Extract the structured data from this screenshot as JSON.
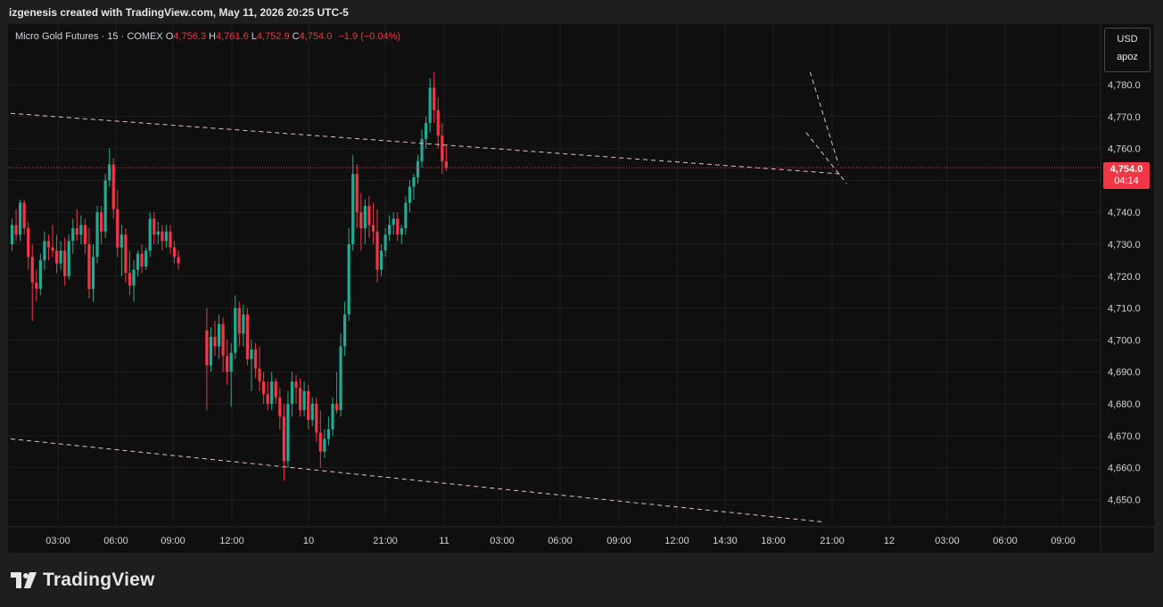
{
  "caption": "izgenesis created with TradingView.com, May 11, 2026 20:25 UTC-5",
  "legend": {
    "symbol": "Micro Gold Futures · 15 · COMEX",
    "o_label": "O",
    "o_value": "4,756.3",
    "h_label": "H",
    "h_value": "4,761.6",
    "l_label": "L",
    "l_value": "4,752.9",
    "c_label": "C",
    "c_value": "4,754.0",
    "change": "−1.9 (−0.04%)"
  },
  "currency": {
    "code": "USD",
    "unit": "apoz"
  },
  "last_price": {
    "price": "4,754.0",
    "countdown": "04:14"
  },
  "brand": "TradingView",
  "colors": {
    "up": "#22ab94",
    "down": "#f23645",
    "background": "#0f0f0f",
    "grid": "#1f1f1f"
  },
  "chart_data": {
    "type": "candlestick",
    "y_ticks": [
      "4,780.0",
      "4,770.0",
      "4,760.0",
      "4,750.0",
      "4,740.0",
      "4,730.0",
      "4,720.0",
      "4,710.0",
      "4,700.0",
      "4,690.0",
      "4,680.0",
      "4,670.0",
      "4,660.0",
      "4,650.0"
    ],
    "ylim": [
      4643,
      4794
    ],
    "x_ticks": [
      "03:00",
      "06:00",
      "09:00",
      "12:00",
      "10",
      "21:00",
      "11",
      "03:00",
      "06:00",
      "09:00",
      "12:00",
      "14:30",
      "18:00",
      "21:00",
      "12",
      "03:00",
      "06:00",
      "09:00"
    ],
    "last_price": 4754.0,
    "trendlines": [
      {
        "from": [
          0,
          4771.0
        ],
        "to": [
          205,
          4752.0
        ]
      },
      {
        "from": [
          0,
          4669.0
        ],
        "to": [
          200,
          4643.0
        ]
      },
      {
        "from": [
          197,
          4784.0
        ],
        "to": [
          204,
          4755.0
        ]
      },
      {
        "from": [
          196,
          4765.0
        ],
        "to": [
          206,
          4749.0
        ]
      }
    ],
    "candles": [
      [
        4730,
        4738,
        4728,
        4736
      ],
      [
        4736,
        4741,
        4731,
        4733
      ],
      [
        4733,
        4744,
        4731,
        4743
      ],
      [
        4743,
        4744,
        4733,
        4735
      ],
      [
        4735,
        4737,
        4722,
        4726
      ],
      [
        4726,
        4730,
        4706,
        4718
      ],
      [
        4718,
        4722,
        4712,
        4716
      ],
      [
        4716,
        4727,
        4714,
        4725
      ],
      [
        4725,
        4734,
        4722,
        4731
      ],
      [
        4731,
        4733,
        4725,
        4729
      ],
      [
        4729,
        4736,
        4726,
        4728
      ],
      [
        4728,
        4733,
        4721,
        4724
      ],
      [
        4724,
        4731,
        4722,
        4728
      ],
      [
        4728,
        4732,
        4717,
        4720
      ],
      [
        4720,
        4733,
        4719,
        4731
      ],
      [
        4731,
        4738,
        4727,
        4735
      ],
      [
        4735,
        4741,
        4731,
        4733
      ],
      [
        4733,
        4739,
        4730,
        4736
      ],
      [
        4736,
        4738,
        4727,
        4730
      ],
      [
        4730,
        4735,
        4713,
        4716
      ],
      [
        4716,
        4730,
        4712,
        4726
      ],
      [
        4726,
        4742,
        4724,
        4740
      ],
      [
        4740,
        4742,
        4730,
        4734
      ],
      [
        4734,
        4752,
        4732,
        4750
      ],
      [
        4750,
        4760,
        4748,
        4755
      ],
      [
        4755,
        4757,
        4738,
        4741
      ],
      [
        4741,
        4747,
        4726,
        4729
      ],
      [
        4729,
        4736,
        4720,
        4733
      ],
      [
        4733,
        4735,
        4718,
        4721
      ],
      [
        4721,
        4728,
        4714,
        4717
      ],
      [
        4717,
        4725,
        4712,
        4722
      ],
      [
        4722,
        4728,
        4720,
        4727
      ],
      [
        4727,
        4730,
        4721,
        4723
      ],
      [
        4723,
        4729,
        4722,
        4728
      ],
      [
        4728,
        4740,
        4726,
        4738
      ],
      [
        4738,
        4740,
        4730,
        4733
      ],
      [
        4733,
        4737,
        4730,
        4734
      ],
      [
        4734,
        4736,
        4728,
        4731
      ],
      [
        4731,
        4736,
        4729,
        4734
      ],
      [
        4734,
        4736,
        4727,
        4729
      ],
      [
        4729,
        4731,
        4724,
        4726
      ],
      [
        4726,
        4728,
        4722,
        4724
      ],
      [
        4703,
        4710,
        4678,
        4692
      ],
      [
        4692,
        4704,
        4690,
        4701
      ],
      [
        4701,
        4706,
        4695,
        4698
      ],
      [
        4698,
        4708,
        4694,
        4705
      ],
      [
        4705,
        4707,
        4690,
        4695
      ],
      [
        4695,
        4700,
        4686,
        4690
      ],
      [
        4690,
        4699,
        4679,
        4696
      ],
      [
        4696,
        4714,
        4694,
        4710
      ],
      [
        4710,
        4712,
        4698,
        4702
      ],
      [
        4702,
        4711,
        4698,
        4708
      ],
      [
        4708,
        4710,
        4692,
        4694
      ],
      [
        4694,
        4700,
        4684,
        4697
      ],
      [
        4697,
        4699,
        4688,
        4691
      ],
      [
        4691,
        4698,
        4684,
        4687
      ],
      [
        4687,
        4690,
        4680,
        4683
      ],
      [
        4683,
        4687,
        4678,
        4680
      ],
      [
        4680,
        4690,
        4678,
        4687
      ],
      [
        4687,
        4688,
        4680,
        4682
      ],
      [
        4682,
        4685,
        4672,
        4676
      ],
      [
        4676,
        4680,
        4656,
        4662
      ],
      [
        4662,
        4684,
        4660,
        4680
      ],
      [
        4680,
        4690,
        4676,
        4687
      ],
      [
        4687,
        4689,
        4680,
        4685
      ],
      [
        4685,
        4688,
        4676,
        4678
      ],
      [
        4678,
        4687,
        4676,
        4684
      ],
      [
        4684,
        4686,
        4672,
        4675
      ],
      [
        4675,
        4682,
        4673,
        4680
      ],
      [
        4680,
        4682,
        4668,
        4671
      ],
      [
        4671,
        4678,
        4660,
        4665
      ],
      [
        4665,
        4672,
        4663,
        4669
      ],
      [
        4669,
        4676,
        4667,
        4672
      ],
      [
        4672,
        4682,
        4670,
        4680
      ],
      [
        4680,
        4690,
        4677,
        4678
      ],
      [
        4678,
        4702,
        4676,
        4698
      ],
      [
        4698,
        4712,
        4695,
        4708
      ],
      [
        4708,
        4735,
        4706,
        4730
      ],
      [
        4730,
        4758,
        4728,
        4752
      ],
      [
        4752,
        4755,
        4735,
        4740
      ],
      [
        4740,
        4746,
        4728,
        4735
      ],
      [
        4735,
        4744,
        4730,
        4742
      ],
      [
        4742,
        4745,
        4732,
        4736
      ],
      [
        4736,
        4743,
        4730,
        4734
      ],
      [
        4734,
        4741,
        4718,
        4722
      ],
      [
        4722,
        4730,
        4720,
        4728
      ],
      [
        4728,
        4735,
        4726,
        4733
      ],
      [
        4733,
        4739,
        4731,
        4736
      ],
      [
        4736,
        4740,
        4733,
        4738
      ],
      [
        4738,
        4740,
        4731,
        4733
      ],
      [
        4733,
        4736,
        4730,
        4735
      ],
      [
        4735,
        4745,
        4733,
        4743
      ],
      [
        4743,
        4750,
        4740,
        4748
      ],
      [
        4748,
        4752,
        4744,
        4751
      ],
      [
        4751,
        4758,
        4749,
        4756
      ],
      [
        4756,
        4766,
        4754,
        4763
      ],
      [
        4763,
        4770,
        4760,
        4768
      ],
      [
        4768,
        4782,
        4765,
        4779
      ],
      [
        4779,
        4784,
        4768,
        4772
      ],
      [
        4772,
        4776,
        4760,
        4764
      ],
      [
        4764,
        4768,
        4752,
        4756
      ],
      [
        4756,
        4761,
        4753,
        4754
      ]
    ]
  }
}
